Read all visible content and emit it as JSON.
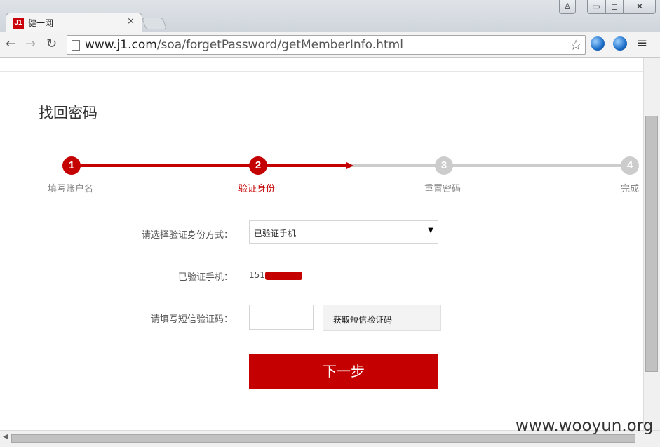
{
  "browser": {
    "tab_title": "健一网",
    "tab_favicon": "J1",
    "tab_close": "×",
    "url_host": "www.j1.com",
    "url_path": "/soa/forgetPassword/getMemberInfo.html",
    "icons": {
      "back": "←",
      "forward": "→",
      "reload": "↻",
      "star": "☆",
      "menu": "≡",
      "user": "♙",
      "minimize": "▭",
      "maximize": "◻",
      "close": "✕"
    }
  },
  "page": {
    "heading": "找回密码",
    "steps": [
      {
        "num": "1",
        "label": "填写账户名",
        "state": "done"
      },
      {
        "num": "2",
        "label": "验证身份",
        "state": "current"
      },
      {
        "num": "3",
        "label": "重置密码",
        "state": "todo"
      },
      {
        "num": "4",
        "label": "完成",
        "state": "todo"
      }
    ],
    "form": {
      "method_label": "请选择验证身份方式：",
      "method_value": "已验证手机",
      "method_arrow": "▼",
      "phone_label": "已验证手机：",
      "phone_prefix": "151",
      "code_label": "请填写短信验证码：",
      "code_value": "",
      "sms_button": "获取短信验证码",
      "next_button": "下一步"
    }
  },
  "watermark": "www.wooyun.org",
  "colors": {
    "accent": "#c40000",
    "inactive": "#cccccc"
  }
}
